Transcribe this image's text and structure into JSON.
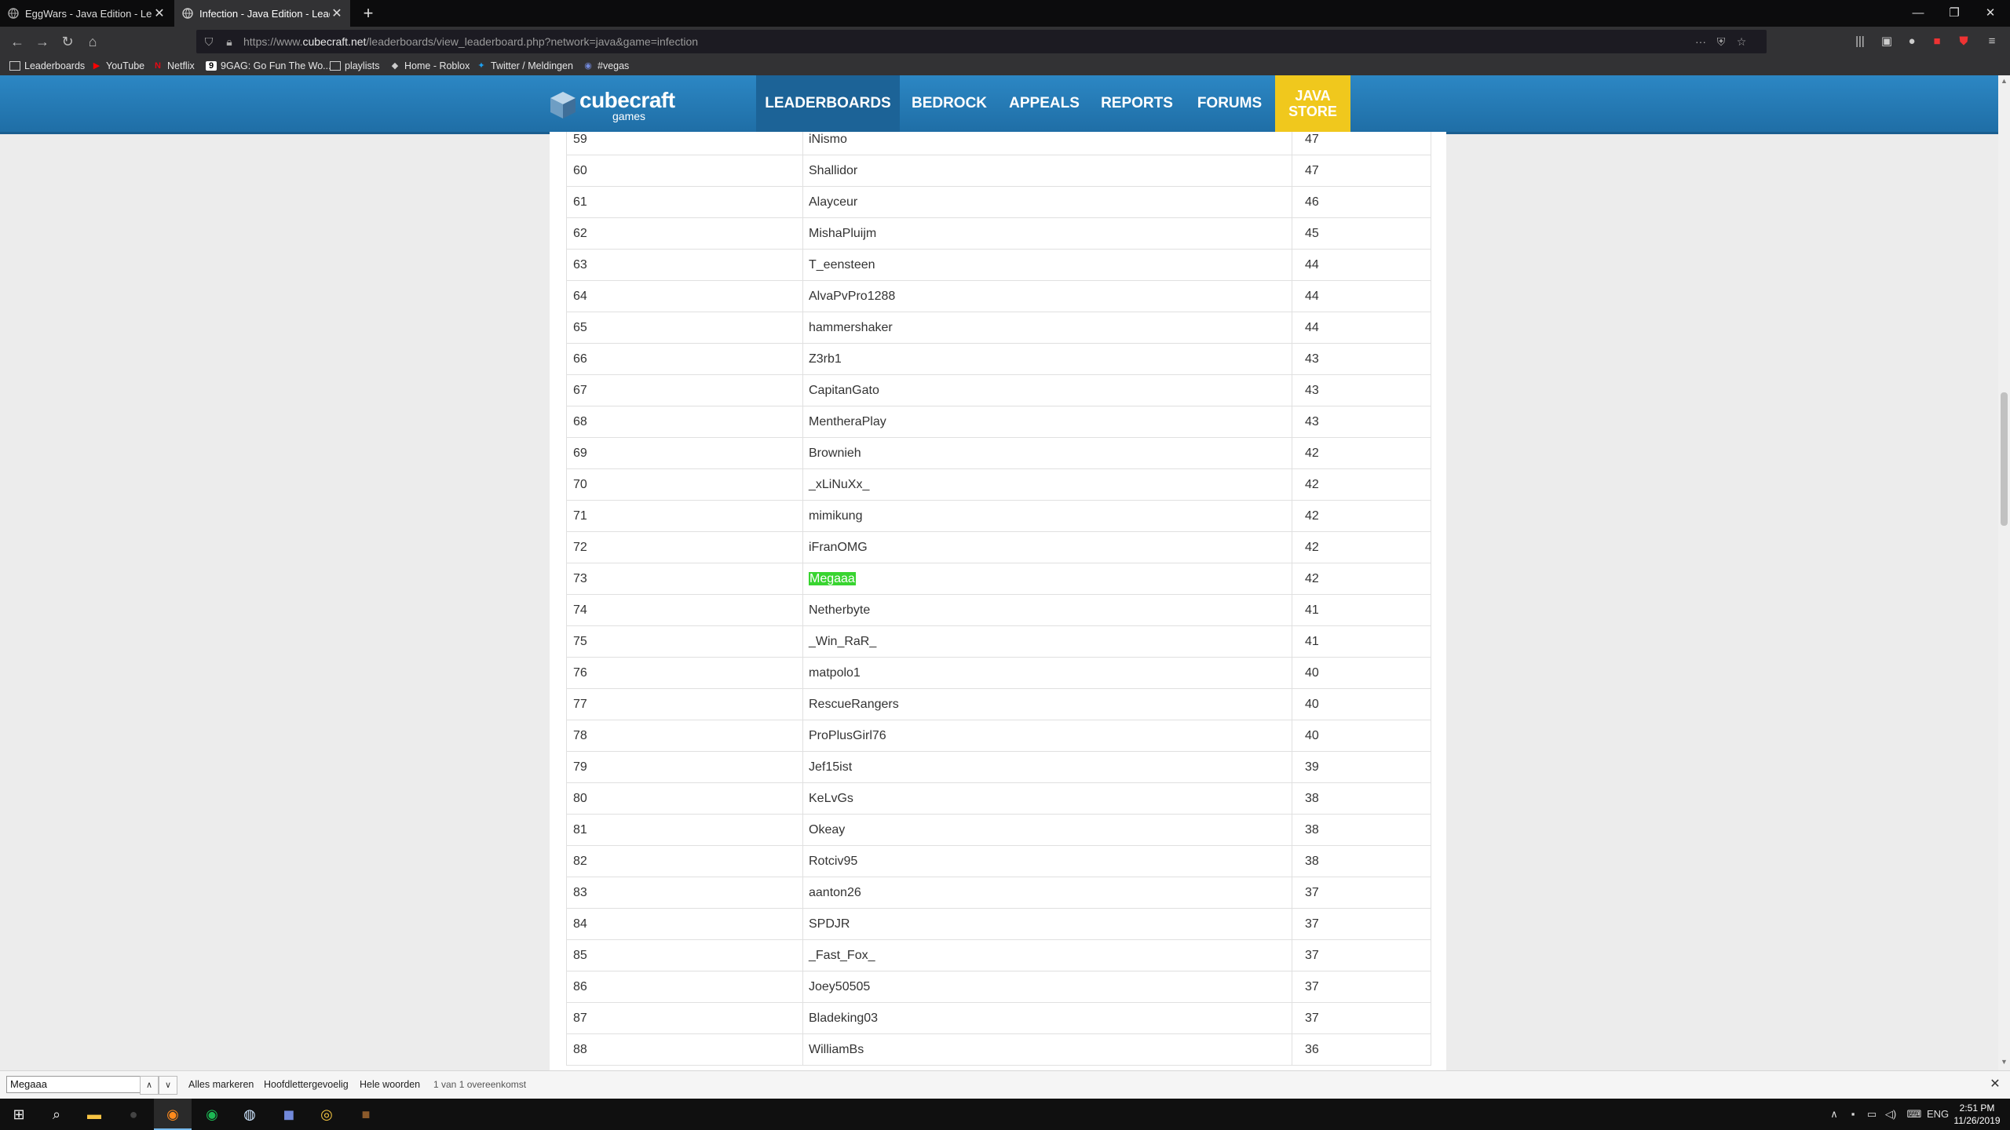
{
  "browser": {
    "tabs": [
      {
        "title": "EggWars - Java Edition - Leade",
        "active": false
      },
      {
        "title": "Infection - Java Edition - Leade",
        "active": true
      }
    ],
    "url_prefix": "https://www.",
    "url_domain": "cubecraft.net",
    "url_path": "/leaderboards/view_leaderboard.php?network=java&game=infection",
    "bookmarks": [
      {
        "label": "Leaderboards",
        "icon": "folder-icon"
      },
      {
        "label": "YouTube",
        "icon": "youtube-icon"
      },
      {
        "label": "Netflix",
        "icon": "netflix-icon"
      },
      {
        "label": "9GAG: Go Fun The Wo...",
        "icon": "9gag-icon"
      },
      {
        "label": "playlists",
        "icon": "folder-icon"
      },
      {
        "label": "Home - Roblox",
        "icon": "roblox-icon"
      },
      {
        "label": "Twitter / Meldingen",
        "icon": "twitter-icon"
      },
      {
        "label": "#vegas",
        "icon": "discord-icon"
      }
    ]
  },
  "site": {
    "logo_text": "cubecraft",
    "logo_sub": "games",
    "nav": [
      "LEADERBOARDS",
      "BEDROCK",
      "APPEALS",
      "REPORTS",
      "FORUMS"
    ],
    "store_line1": "JAVA",
    "store_line2": "STORE",
    "accent": "#2c87c4",
    "store_color": "#f0c81d"
  },
  "leaderboard": {
    "rows": [
      {
        "rank": "59",
        "name": "iNismo",
        "score": "47"
      },
      {
        "rank": "60",
        "name": "Shallidor",
        "score": "47"
      },
      {
        "rank": "61",
        "name": "Alayceur",
        "score": "46"
      },
      {
        "rank": "62",
        "name": "MishaPluijm",
        "score": "45"
      },
      {
        "rank": "63",
        "name": "T_eensteen",
        "score": "44"
      },
      {
        "rank": "64",
        "name": "AlvaPvPro1288",
        "score": "44"
      },
      {
        "rank": "65",
        "name": "hammershaker",
        "score": "44"
      },
      {
        "rank": "66",
        "name": "Z3rb1",
        "score": "43"
      },
      {
        "rank": "67",
        "name": "CapitanGato",
        "score": "43"
      },
      {
        "rank": "68",
        "name": "MentheraPlay",
        "score": "43"
      },
      {
        "rank": "69",
        "name": "Brownieh",
        "score": "42"
      },
      {
        "rank": "70",
        "name": "_xLiNuXx_",
        "score": "42"
      },
      {
        "rank": "71",
        "name": "mimikung",
        "score": "42"
      },
      {
        "rank": "72",
        "name": "iFranOMG",
        "score": "42"
      },
      {
        "rank": "73",
        "name": "Megaaa",
        "score": "42",
        "highlight": true
      },
      {
        "rank": "74",
        "name": "Netherbyte",
        "score": "41"
      },
      {
        "rank": "75",
        "name": "_Win_RaR_",
        "score": "41"
      },
      {
        "rank": "76",
        "name": "matpolo1",
        "score": "40"
      },
      {
        "rank": "77",
        "name": "RescueRangers",
        "score": "40"
      },
      {
        "rank": "78",
        "name": "ProPlusGirl76",
        "score": "40"
      },
      {
        "rank": "79",
        "name": "Jef15ist",
        "score": "39"
      },
      {
        "rank": "80",
        "name": "KeLvGs",
        "score": "38"
      },
      {
        "rank": "81",
        "name": "Okeay",
        "score": "38"
      },
      {
        "rank": "82",
        "name": "Rotciv95",
        "score": "38"
      },
      {
        "rank": "83",
        "name": "aanton26",
        "score": "37"
      },
      {
        "rank": "84",
        "name": "SPDJR",
        "score": "37"
      },
      {
        "rank": "85",
        "name": "_Fast_Fox_",
        "score": "37"
      },
      {
        "rank": "86",
        "name": "Joey50505",
        "score": "37"
      },
      {
        "rank": "87",
        "name": "Bladeking03",
        "score": "37"
      },
      {
        "rank": "88",
        "name": "WilliamBs",
        "score": "36"
      }
    ]
  },
  "findbar": {
    "query": "Megaaa",
    "highlight_all": "Alles markeren",
    "match_case": "Hoofdlettergevoelig",
    "whole_words": "Hele woorden",
    "status": "1 van 1 overeenkomst"
  },
  "taskbar": {
    "language": "ENG",
    "time": "2:51 PM",
    "date": "11/26/2019"
  }
}
